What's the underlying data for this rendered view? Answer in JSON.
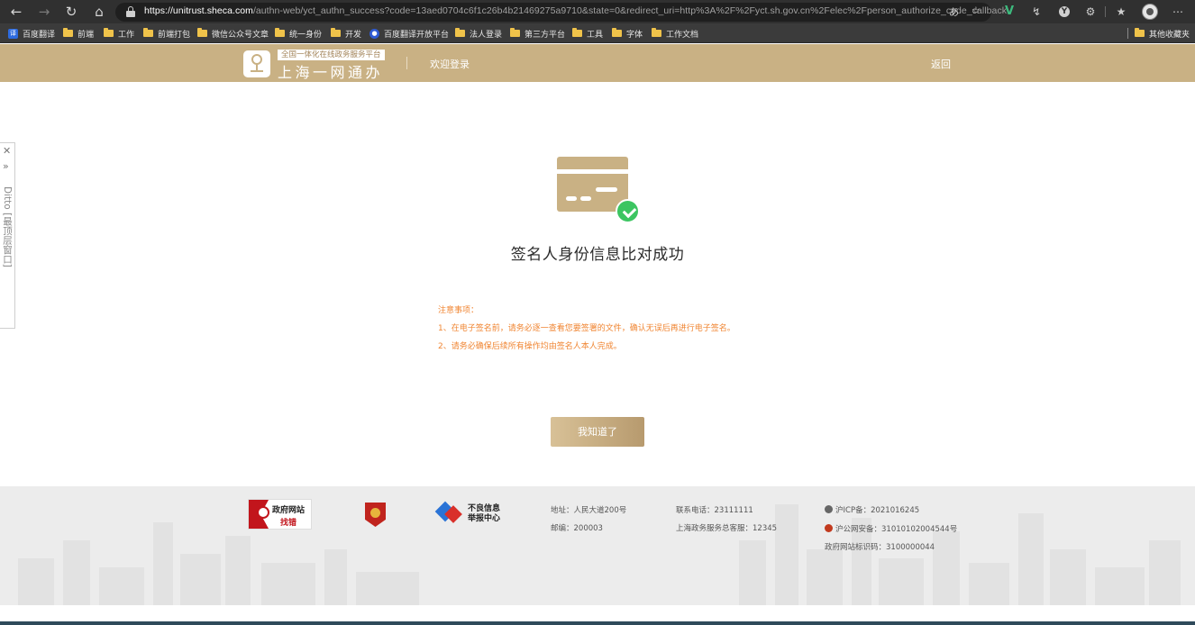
{
  "browser": {
    "url_host": "https://unitrust.sheca.com",
    "url_rest": "/authn-web/yct_authn_success?code=13aed0704c6f1c26b4b21469275a9710&state=0&redirect_uri=http%3A%2F%2Fyct.sh.gov.cn%2Felec%2Fperson_authorize_code_callback",
    "icons": [
      "back-arrow-icon",
      "forward-arrow-icon",
      "refresh-icon",
      "home-icon",
      "lock-icon",
      "read-aloud-icon",
      "favorite-add-icon",
      "vue-devtools-icon",
      "extension-icon",
      "yandex-icon",
      "extensions-puzzle-icon",
      "favorites-icon",
      "profile-avatar",
      "more-menu-icon"
    ]
  },
  "bookmarks": {
    "items": [
      "百度翻译",
      "前端",
      "工作",
      "前端打包",
      "微信公众号文章",
      "统一身份",
      "开发",
      "百度翻译开放平台",
      "法人登录",
      "第三方平台",
      "工具",
      "字体",
      "工作文档"
    ],
    "other": "其他收藏夹"
  },
  "header": {
    "logo_tag": "全国一体化在线政务服务平台",
    "logo_main": "上海一网通办",
    "welcome": "欢迎登录",
    "back": "返回"
  },
  "ditto": {
    "label": "Ditto [最顶层窗口]"
  },
  "main": {
    "title": "签名人身份信息比对成功",
    "notice_title": "注意事项：",
    "notice_items": [
      "1、在电子签名前，请务必逐一查看您要签署的文件，确认无误后再进行电子签名。",
      "2、请务必确保后续所有操作均由签名人本人完成。"
    ],
    "button": "我知道了"
  },
  "footer": {
    "badge_gov_line1": "政府网站",
    "badge_gov_line2": "找错",
    "badge_report_line1": "不良信息",
    "badge_report_line2": "举报中心",
    "address": "地址：人民大道200号",
    "postcode": "邮编：200003",
    "phone": "联系电话：23111111",
    "hotline": "上海政务服务总客服：12345",
    "icp": "沪ICP备：2021016245",
    "police": "沪公网安备：31010102004544号",
    "site_id": "政府网站标识码：3100000044"
  },
  "colors": {
    "brand_gold": "#c9b184",
    "notice_orange": "#f08532",
    "success_green": "#3cc561"
  }
}
